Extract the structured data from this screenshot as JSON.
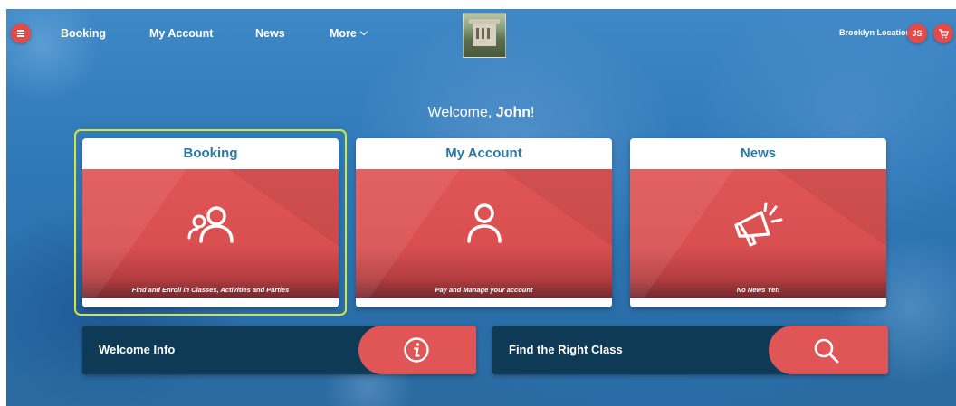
{
  "nav": {
    "links": [
      "Booking",
      "My Account",
      "News",
      "More"
    ],
    "location": "Brooklyn Location",
    "avatar_initials": "JS"
  },
  "welcome": {
    "prefix": "Welcome, ",
    "name": "John",
    "suffix": "!"
  },
  "cards": [
    {
      "title": "Booking",
      "caption": "Find and Enroll in Classes, Activities and Parties",
      "icon": "users-icon",
      "selected": true
    },
    {
      "title": "My Account",
      "caption": "Pay and Manage your account",
      "icon": "user-icon"
    },
    {
      "title": "News",
      "caption": "No News Yet!",
      "icon": "megaphone-icon"
    }
  ],
  "panels": [
    {
      "label": "Welcome Info",
      "icon": "info-icon"
    },
    {
      "label": "Find the Right Class",
      "icon": "search-icon"
    }
  ],
  "colors": {
    "accent": "#e05556",
    "title": "#2b7aa6",
    "panel": "#0e3a55",
    "highlight": "#d7e636"
  }
}
